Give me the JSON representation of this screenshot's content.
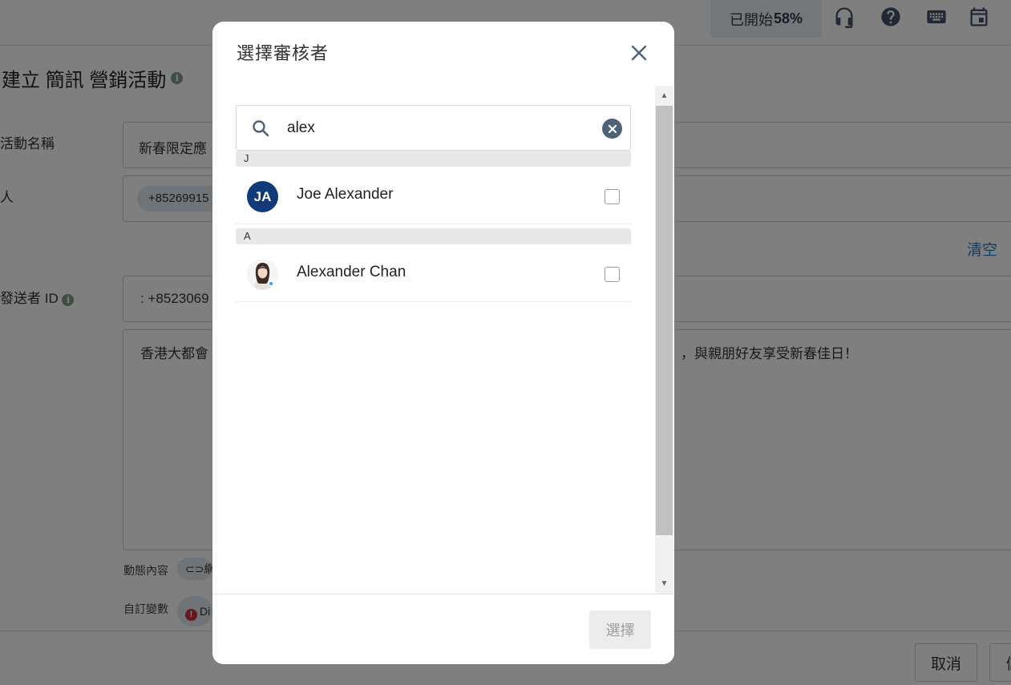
{
  "topbar": {
    "progress_prefix": "已開始",
    "progress_value": "58%",
    "icons": [
      "headset-icon",
      "help-icon",
      "keyboard-icon",
      "calendar-icon"
    ]
  },
  "page": {
    "title": "建立 簡訊 營銷活動",
    "campaign_name_label": "活動名稱",
    "campaign_name_value": "新春限定應",
    "recipient_label": "人",
    "recipient_chip": "+85269915",
    "clear_link": "清空",
    "sender_label": "發送者 ID",
    "sender_value": ": +8523069",
    "message_left": "香港大都會",
    "message_right": "，與親朋好友享受新春佳日！",
    "dynamic_label": "動態內容",
    "dynamic_chip": "網",
    "custom_label": "自訂變數",
    "custom_chip": "Di",
    "cancel_button": "取消",
    "next_button": "儲"
  },
  "modal": {
    "title": "選擇審核者",
    "search_value": "alex",
    "groups": [
      {
        "header": "J",
        "items": [
          {
            "name": "Joe Alexander",
            "initials": "JA",
            "checked": false
          }
        ]
      },
      {
        "header": "A",
        "items": [
          {
            "name": "Alexander Chan",
            "checked": false
          }
        ]
      }
    ],
    "select_button": "選擇"
  },
  "colors": {
    "overlay": "#00000080",
    "avatar_bg": "#103a78",
    "link": "#2b7bc8",
    "clear_icon_bg": "#4d6275"
  }
}
